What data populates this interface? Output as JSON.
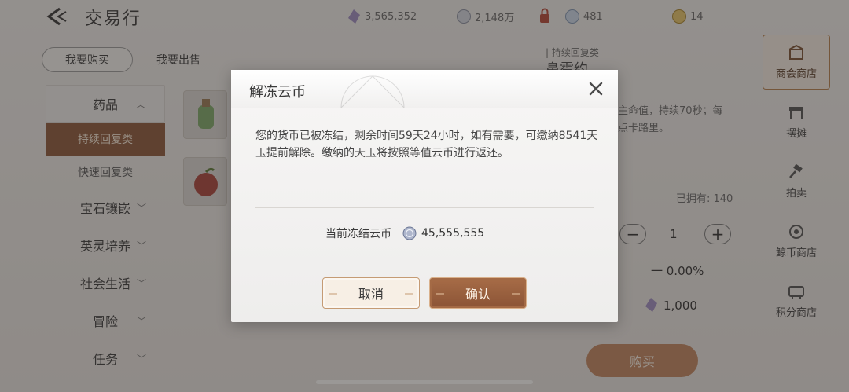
{
  "app": {
    "title": "交易行",
    "currencies": [
      {
        "icon": "crystal-currency-icon",
        "value": "3,565,352"
      },
      {
        "icon": "silver-coin-icon",
        "value": "2,148万"
      },
      {
        "icon": "frozen-coin-icon",
        "value": "481"
      },
      {
        "icon": "gold-coin-icon",
        "value": "14"
      }
    ]
  },
  "tabs": {
    "buy": "我要购买",
    "sell": "我要出售"
  },
  "sidebar": {
    "open_category": "药品",
    "sub_items": [
      "持续回复类",
      "快速回复类"
    ],
    "categories": [
      "宝石镶嵌",
      "英灵培养",
      "社会生活",
      "冒险",
      "任务"
    ]
  },
  "item_detail": {
    "category_label": "| 持续回复类",
    "name_partial": "鼻霉约",
    "desc_line1": "主命值，持续70秒；每",
    "desc_line2": "点卡路里。",
    "owned": "已拥有: 140",
    "quantity": "1",
    "percent": "一 0.00%",
    "price": "1,000",
    "buy_label": "购买"
  },
  "right_panel": [
    {
      "label": "商会商店",
      "icon": "shop-icon"
    },
    {
      "label": "摆摊",
      "icon": "stall-icon"
    },
    {
      "label": "拍卖",
      "icon": "gavel-icon"
    },
    {
      "label": "鲸币商店",
      "icon": "whale-coin-icon"
    },
    {
      "label": "积分商店",
      "icon": "points-shop-icon"
    }
  ],
  "dialog": {
    "title": "解冻云币",
    "message": "您的货币已被冻结，剩余时间59天24小时，如有需要，可缴纳8541天玉提前解除。缴纳的天玉将按照等值云币进行返还。",
    "frozen_label": "当前冻结云币",
    "frozen_value": "45,555,555",
    "cancel_label": "取消",
    "confirm_label": "确认"
  }
}
